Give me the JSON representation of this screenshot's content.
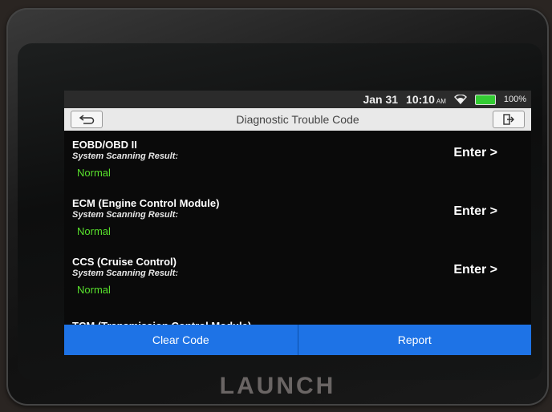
{
  "device": {
    "brand": "LAUNCH"
  },
  "status_bar": {
    "date": "Jan 31",
    "time": "10:10",
    "ampm": "AM",
    "battery": "100%",
    "battery_color": "#33cc33"
  },
  "title_bar": {
    "title": "Diagnostic Trouble Code",
    "back_icon": "back-arrow-icon",
    "exit_icon": "exit-door-icon"
  },
  "modules": [
    {
      "name": "EOBD/OBD II",
      "label": "System Scanning Result:",
      "status": "Normal",
      "action": "Enter >"
    },
    {
      "name": "ECM (Engine Control Module)",
      "label": "System Scanning Result:",
      "status": "Normal",
      "action": "Enter >"
    },
    {
      "name": "CCS (Cruise Control)",
      "label": "System Scanning Result:",
      "status": "Normal",
      "action": "Enter >"
    }
  ],
  "partial_item": "TCM (Transmission Control Module)",
  "bottom_buttons": {
    "clear": "Clear Code",
    "report": "Report"
  },
  "colors": {
    "accent": "#1e73e6",
    "normal_status": "#58e02c"
  }
}
